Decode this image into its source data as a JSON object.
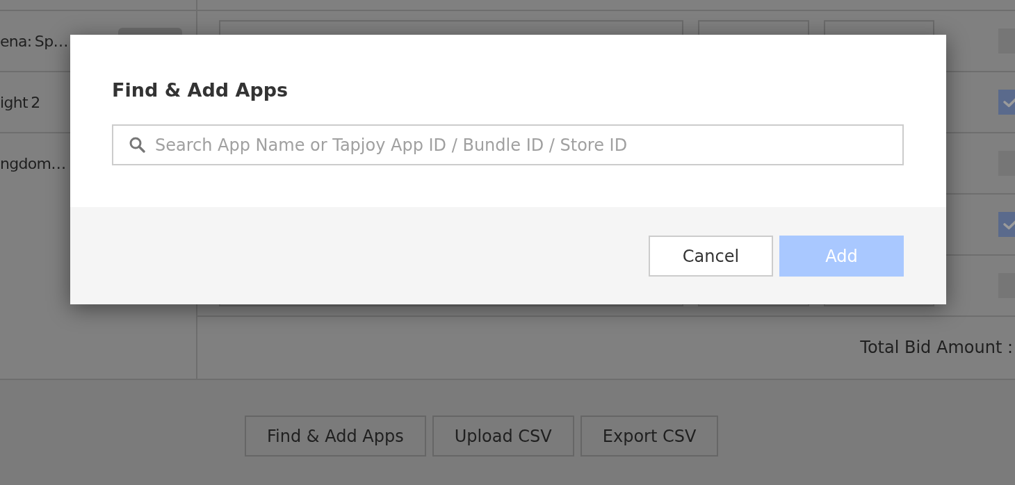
{
  "sidebar_rows": [
    {
      "label": "ena: Sp…",
      "pill": true
    },
    {
      "label": "ight 2",
      "pill": false
    },
    {
      "label": "ngdom…",
      "pill": false
    }
  ],
  "bid_rows": [
    {
      "checked": false
    },
    {
      "checked": true
    },
    {
      "checked": false
    },
    {
      "checked": true
    },
    {
      "checked": false
    }
  ],
  "total_label": "Total Bid Amount :",
  "actions": [
    "Find & Add Apps",
    "Upload CSV",
    "Export CSV"
  ],
  "modal": {
    "title": "Find & Add Apps",
    "search": {
      "placeholder": "Search App Name or Tapjoy App ID / Bundle ID / Store ID"
    },
    "buttons": [
      {
        "label": "Cancel",
        "kind": "secondary",
        "disabled": false
      },
      {
        "label": "Add",
        "kind": "primary",
        "disabled": true
      }
    ]
  }
}
